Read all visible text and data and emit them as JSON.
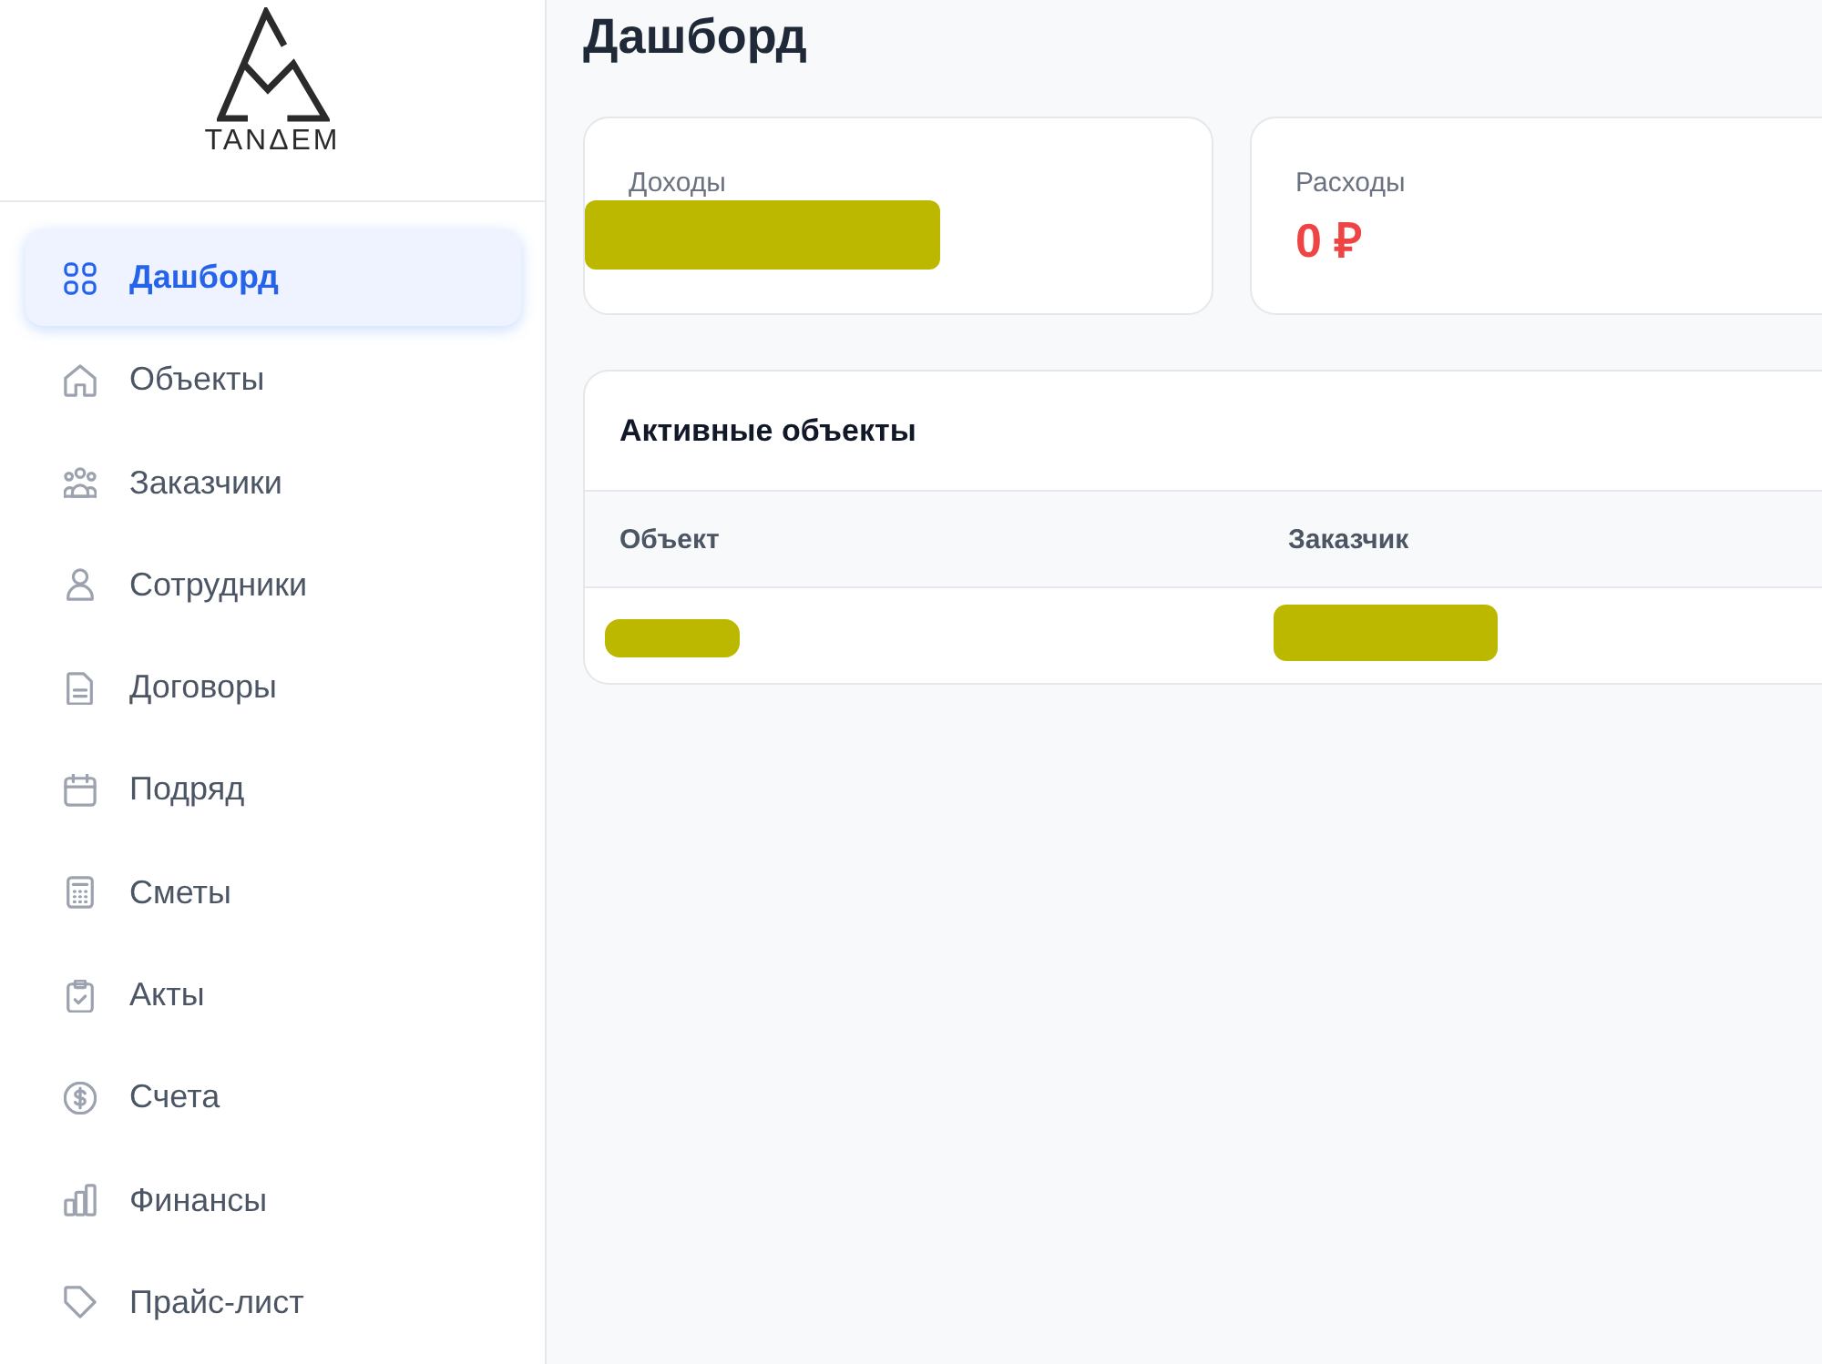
{
  "logo": {
    "text": "TANΔEM"
  },
  "sidebar": {
    "items": [
      {
        "label": "Дашборд",
        "selected": true
      },
      {
        "label": "Объекты",
        "selected": false
      },
      {
        "label": "Заказчики",
        "selected": false
      },
      {
        "label": "Сотрудники",
        "selected": false
      },
      {
        "label": "Договоры",
        "selected": false
      },
      {
        "label": "Подряд",
        "selected": false
      },
      {
        "label": "Сметы",
        "selected": false
      },
      {
        "label": "Акты",
        "selected": false
      },
      {
        "label": "Счета",
        "selected": false
      },
      {
        "label": "Финансы",
        "selected": false
      },
      {
        "label": "Прайс-лист",
        "selected": false
      }
    ]
  },
  "page": {
    "title": "Дашборд"
  },
  "stat_cards": [
    {
      "label": "Доходы",
      "redacted": true
    },
    {
      "label": "Расходы",
      "value": "0 ₽",
      "redacted": false
    }
  ],
  "active_objects": {
    "title": "Активные объекты",
    "columns": [
      "Объект",
      "Заказчик"
    ],
    "rows": [
      {
        "cells": [
          {
            "redacted": true
          },
          {
            "redacted": true
          }
        ]
      }
    ]
  }
}
